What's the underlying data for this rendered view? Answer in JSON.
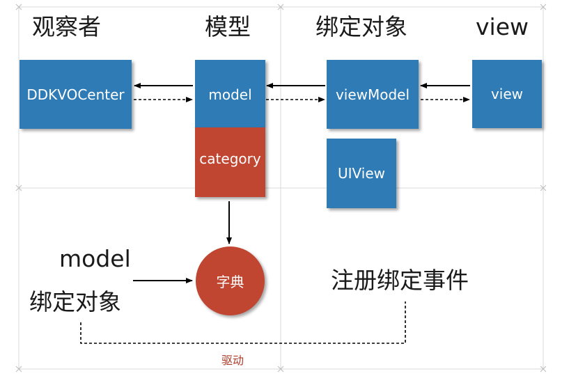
{
  "headings": {
    "observer": "观察者",
    "model": "模型",
    "binding_object": "绑定对象",
    "view": "view"
  },
  "boxes": {
    "ddkvo_center": "DDKVOCenter",
    "model": "model",
    "category": "category",
    "view_model": "viewModel",
    "uiview": "UIView",
    "view": "view"
  },
  "dictionary": "字典",
  "left_label": {
    "line1": "model",
    "line2": "绑定对象"
  },
  "register_event": "注册绑定事件",
  "drive_label": "驱动",
  "colors": {
    "blue": "#2e7bb6",
    "red": "#c04632",
    "grid": "#d4d4d4"
  }
}
